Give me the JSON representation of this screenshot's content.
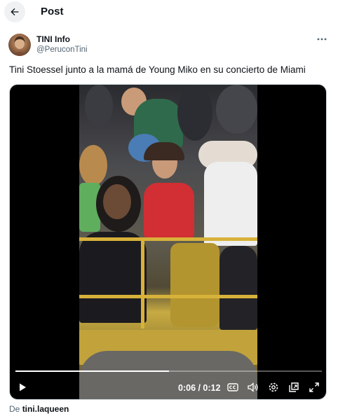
{
  "header": {
    "title": "Post",
    "back_icon": "arrow-left-icon"
  },
  "author": {
    "display_name": "TINI Info",
    "handle": "@PeruconTini",
    "more_icon": "more-horizontal-icon"
  },
  "post": {
    "text": "Tini Stoessel junto a la mamá de Young Miko en su concierto de Miami"
  },
  "video": {
    "current_time": "0:06",
    "duration": "0:12",
    "time_display": "0:06 / 0:12",
    "progress": 0.5,
    "controls": [
      "play-icon",
      "captions-icon",
      "volume-icon",
      "settings-icon",
      "popout-icon",
      "fullscreen-icon"
    ]
  },
  "source": {
    "prefix": "De",
    "user": "tini.laqueen"
  },
  "colors": {
    "text": "#0f1419",
    "secondary": "#536471",
    "media_bg": "#000000"
  }
}
